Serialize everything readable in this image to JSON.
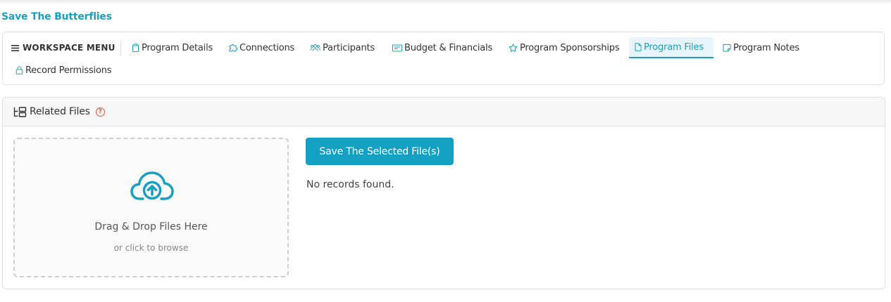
{
  "program": {
    "title": "Save The Butterflies"
  },
  "workspace_menu": {
    "label": "WORKSPACE MENU",
    "tabs": [
      {
        "label": "Program Details",
        "icon": "clipboard-icon",
        "active": false
      },
      {
        "label": "Connections",
        "icon": "puzzle-icon",
        "active": false
      },
      {
        "label": "Participants",
        "icon": "users-icon",
        "active": false
      },
      {
        "label": "Budget & Financials",
        "icon": "card-icon",
        "active": false
      },
      {
        "label": "Program Sponsorships",
        "icon": "star-icon",
        "active": false
      },
      {
        "label": "Program Files",
        "icon": "file-icon",
        "active": true
      },
      {
        "label": "Program Notes",
        "icon": "note-icon",
        "active": false
      },
      {
        "label": "Record Permissions",
        "icon": "lock-icon",
        "active": false
      }
    ]
  },
  "related_files": {
    "title": "Related Files",
    "help_icon": "?",
    "dropzone": {
      "title": "Drag & Drop Files Here",
      "subtitle": "or click to browse",
      "icon": "cloud-upload-icon"
    },
    "save_button": "Save The Selected File(s)",
    "empty_message": "No records found."
  },
  "colors": {
    "accent": "#1a9fbe",
    "button": "#13a1c3",
    "help": "#e8532b"
  }
}
